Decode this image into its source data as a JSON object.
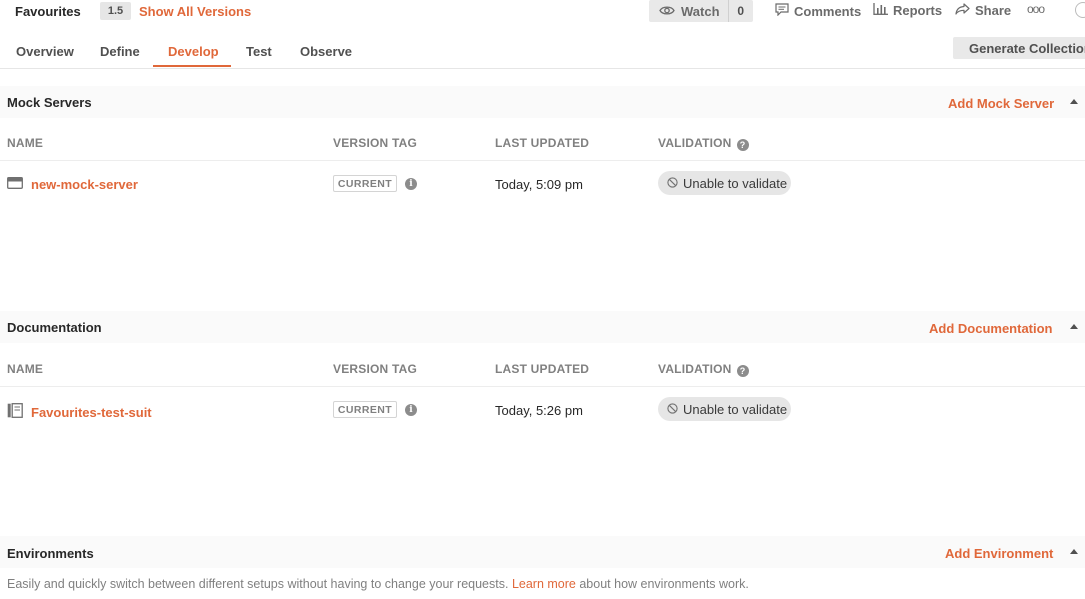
{
  "header": {
    "api_name": "Favourites",
    "version": "1.5",
    "show_versions": "Show All Versions",
    "watch_label": "Watch",
    "watch_count": "0",
    "comments_label": "Comments",
    "reports_label": "Reports",
    "share_label": "Share",
    "more_icon": "ooo"
  },
  "tabs": [
    {
      "label": "Overview",
      "active": false
    },
    {
      "label": "Define",
      "active": false
    },
    {
      "label": "Develop",
      "active": true
    },
    {
      "label": "Test",
      "active": false
    },
    {
      "label": "Observe",
      "active": false
    }
  ],
  "generate_button": "Generate Collection",
  "columns": {
    "name": "NAME",
    "version_tag": "VERSION TAG",
    "last_updated": "LAST UPDATED",
    "validation": "VALIDATION"
  },
  "mock_servers": {
    "title": "Mock Servers",
    "add_label": "Add Mock Server",
    "rows": [
      {
        "name": "new-mock-server",
        "icon": "server-icon",
        "version_tag": "CURRENT",
        "last_updated": "Today, 5:09 pm",
        "validation": "Unable to validate"
      }
    ]
  },
  "documentation": {
    "title": "Documentation",
    "add_label": "Add Documentation",
    "rows": [
      {
        "name": "Favourites-test-suit",
        "icon": "document-icon",
        "version_tag": "CURRENT",
        "last_updated": "Today, 5:26 pm",
        "validation": "Unable to validate"
      }
    ]
  },
  "environments": {
    "title": "Environments",
    "add_label": "Add Environment",
    "description_before": "Easily and quickly switch between different setups without having to change your requests.",
    "learn_more": "Learn more",
    "description_after": "about how environments work."
  },
  "colors": {
    "accent": "#e0683a",
    "text": "#282828",
    "muted": "#808080",
    "section_bg": "#fafafa",
    "pill_bg": "#e6e6e6"
  }
}
